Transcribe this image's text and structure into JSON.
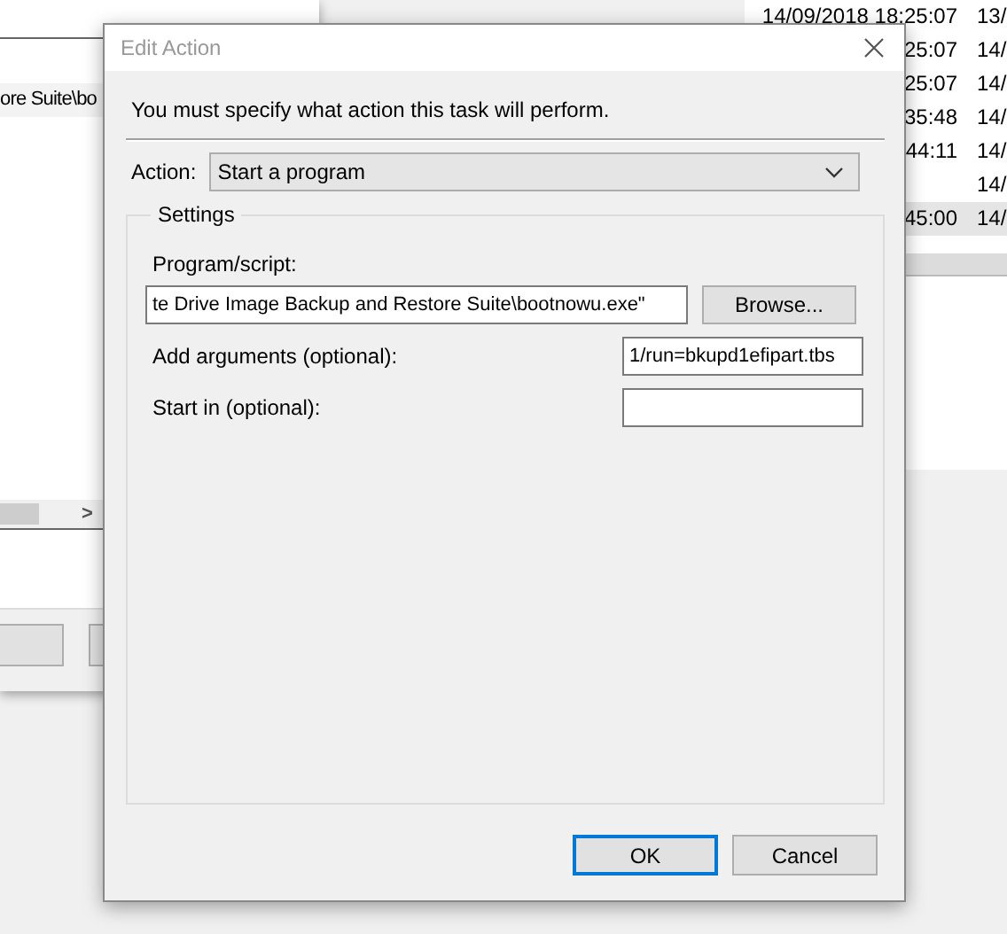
{
  "background_windows": {
    "left": {
      "path_fragment": "ore Suite\\bo",
      "scroll_right": ">"
    },
    "right": {
      "rows": [
        {
          "time": "14/09/2018 18:25:07",
          "date": "13/",
          "selected": false
        },
        {
          "time": "25:07",
          "date": "14/",
          "selected": false
        },
        {
          "time": "25:07",
          "date": "14/",
          "selected": false
        },
        {
          "time": "35:48",
          "date": "14/",
          "selected": false
        },
        {
          "time": "44:11",
          "date": "14/",
          "selected": false
        },
        {
          "date": "14/",
          "selected": false
        },
        {
          "time": "45:00",
          "date": "14/",
          "selected": true
        }
      ]
    }
  },
  "dialog": {
    "title": "Edit Action",
    "message": "You must specify what action this task will perform.",
    "action": {
      "label": "Action:",
      "value": "Start a program"
    },
    "settings": {
      "title": "Settings",
      "program_label": "Program/script:",
      "program_value": "te Drive Image Backup and Restore Suite\\bootnowu.exe\"",
      "browse": "Browse...",
      "fields": [
        {
          "label": "Add arguments (optional):",
          "value": "1/run=bkupd1efipart.tbs"
        },
        {
          "label": "Start in (optional):"
        }
      ]
    },
    "buttons": [
      {
        "label": "OK",
        "default": true
      },
      {
        "label": "Cancel",
        "default": false
      }
    ]
  }
}
